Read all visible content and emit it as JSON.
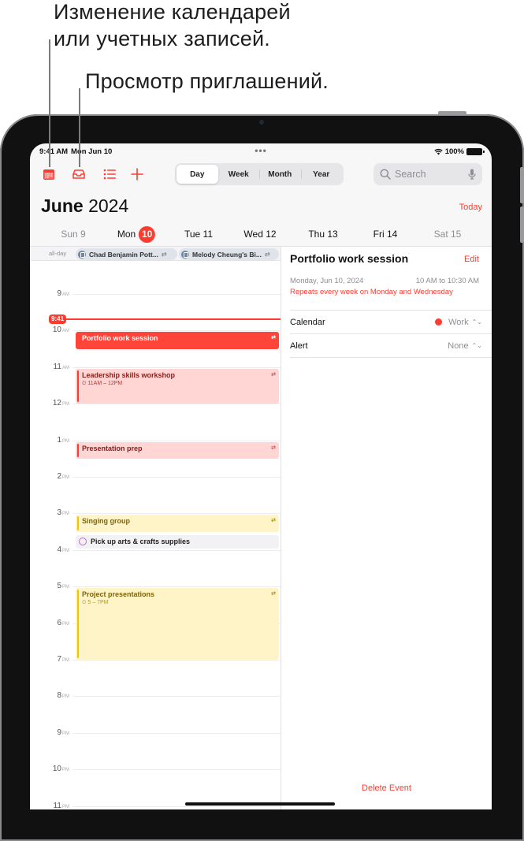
{
  "callouts": {
    "calendars_line1": "Изменение календарей",
    "calendars_line2": "или учетных записей.",
    "invitations": "Просмотр приглашений."
  },
  "status_bar": {
    "time": "9:41 AM",
    "date": "Mon Jun 10",
    "dots": "•••",
    "battery": "100%",
    "wifi_icon": "wifi-icon",
    "battery_icon": "battery-icon"
  },
  "toolbar": {
    "icons": [
      "calendar-icon",
      "inbox-icon",
      "list-icon",
      "plus-icon"
    ],
    "view_tabs": [
      {
        "label": "Day",
        "active": true
      },
      {
        "label": "Week",
        "active": false
      },
      {
        "label": "Month",
        "active": false
      },
      {
        "label": "Year",
        "active": false
      }
    ],
    "search_placeholder": "Search"
  },
  "header": {
    "month": "June",
    "year": "2024",
    "today_label": "Today"
  },
  "week": [
    {
      "label": "Sun 9",
      "weekend": true
    },
    {
      "label": "Mon",
      "badge": "10",
      "selected": true
    },
    {
      "label": "Tue 11"
    },
    {
      "label": "Wed 12"
    },
    {
      "label": "Thu 13"
    },
    {
      "label": "Fri 14"
    },
    {
      "label": "Sat 15",
      "weekend": true
    }
  ],
  "allday": {
    "label": "all-day",
    "events": [
      {
        "title": "Chad Benjamin Pott...",
        "repeat": "⇄"
      },
      {
        "title": "Melody Cheung's Bi...",
        "repeat": "⇄"
      }
    ]
  },
  "hours": [
    {
      "num": "9",
      "suffix": "AM"
    },
    {
      "num": "10",
      "suffix": "AM"
    },
    {
      "num": "11",
      "suffix": "AM"
    },
    {
      "num": "12",
      "suffix": "PM"
    },
    {
      "num": "1",
      "suffix": "PM"
    },
    {
      "num": "2",
      "suffix": "PM"
    },
    {
      "num": "3",
      "suffix": "PM"
    },
    {
      "num": "4",
      "suffix": "PM"
    },
    {
      "num": "5",
      "suffix": "PM"
    },
    {
      "num": "6",
      "suffix": "PM"
    },
    {
      "num": "7",
      "suffix": "PM"
    },
    {
      "num": "8",
      "suffix": "PM"
    },
    {
      "num": "9",
      "suffix": "PM"
    },
    {
      "num": "10",
      "suffix": "PM"
    },
    {
      "num": "11",
      "suffix": "PM"
    }
  ],
  "now": {
    "label": "9:41",
    "hour": 9.683
  },
  "events": [
    {
      "title": "Portfolio work session",
      "start": 10,
      "end": 10.5,
      "style": "red",
      "repeat": "⇄"
    },
    {
      "title": "Leadership skills workshop",
      "time": "⏲ 11AM – 12PM",
      "start": 11,
      "end": 12,
      "style": "pink",
      "repeat": "⇄"
    },
    {
      "title": "Presentation prep",
      "start": 13,
      "end": 13.5,
      "style": "pink",
      "repeat": "⇄"
    },
    {
      "title": "Singing group",
      "start": 15,
      "end": 15.5,
      "style": "yellow",
      "repeat": "⇄"
    },
    {
      "title": "Project presentations",
      "time": "⏲ 5 – 7PM",
      "start": 17,
      "end": 19,
      "style": "yellow",
      "repeat": "⇄"
    }
  ],
  "reminders": [
    {
      "title": "Pick up arts & crafts supplies",
      "at": 15.55
    }
  ],
  "detail": {
    "title": "Portfolio work session",
    "edit_label": "Edit",
    "date": "Monday, Jun 10, 2024",
    "time": "10 AM to 10:30 AM",
    "repeat": "Repeats every week on Monday and Wednesday",
    "calendar_label": "Calendar",
    "calendar_value": "Work",
    "calendar_color": "#ff3b30",
    "alert_label": "Alert",
    "alert_value": "None",
    "delete_label": "Delete Event"
  },
  "colors": {
    "accent": "#ff3b30",
    "event_pink": "#ffd6d4",
    "event_yellow": "#fff4c7"
  }
}
